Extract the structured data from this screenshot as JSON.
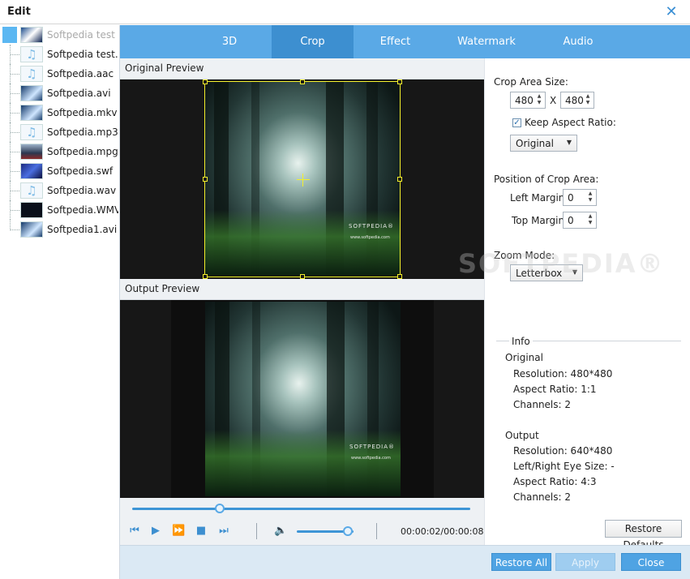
{
  "window": {
    "title": "Edit",
    "close_glyph": "✕"
  },
  "files": [
    {
      "name": "Softpedia test ...",
      "thumb": "video1",
      "selected": true
    },
    {
      "name": "Softpedia test...",
      "thumb": "audio"
    },
    {
      "name": "Softpedia.aac",
      "thumb": "audio"
    },
    {
      "name": "Softpedia.avi",
      "thumb": "video4"
    },
    {
      "name": "Softpedia.mkv",
      "thumb": "video4"
    },
    {
      "name": "Softpedia.mp3",
      "thumb": "audio"
    },
    {
      "name": "Softpedia.mpg",
      "thumb": "video2"
    },
    {
      "name": "Softpedia.swf",
      "thumb": "video3"
    },
    {
      "name": "Softpedia.wav",
      "thumb": "audio"
    },
    {
      "name": "Softpedia.WMV",
      "thumb": "dark"
    },
    {
      "name": "Softpedia1.avi",
      "thumb": "video4"
    }
  ],
  "tabs": [
    {
      "label": "3D"
    },
    {
      "label": "Crop",
      "active": true
    },
    {
      "label": "Effect"
    },
    {
      "label": "Watermark"
    },
    {
      "label": "Audio"
    }
  ],
  "preview": {
    "original_label": "Original Preview",
    "output_label": "Output Preview",
    "scene_logo": "SOFTPEDIA®",
    "scene_url": "www.softpedia.com"
  },
  "playback": {
    "timecode": "00:00:02/00:00:08",
    "progress": 0.26,
    "volume": 0.9
  },
  "crop": {
    "area_size_label": "Crop Area Size:",
    "width": "480",
    "x_label": "X",
    "height": "480",
    "keep_aspect_label": "Keep Aspect Ratio:",
    "keep_aspect_checked": true,
    "aspect_value": "Original",
    "position_label": "Position of Crop Area:",
    "left_margin_label": "Left Margin:",
    "left_margin": "0",
    "top_margin_label": "Top Margin:",
    "top_margin": "0",
    "zoom_label": "Zoom Mode:",
    "zoom_value": "Letterbox"
  },
  "info": {
    "title": "Info",
    "original_label": "Original",
    "original_resolution": "Resolution: 480*480",
    "original_aspect": "Aspect Ratio: 1:1",
    "original_channels": "Channels: 2",
    "output_label": "Output",
    "output_resolution": "Resolution: 640*480",
    "output_eye": "Left/Right Eye Size: -",
    "output_aspect": "Aspect Ratio: 4:3",
    "output_channels": "Channels: 2"
  },
  "buttons": {
    "restore_defaults": "Restore Defaults",
    "restore_all": "Restore All",
    "apply": "Apply",
    "close": "Close"
  },
  "watermark_text": "SOFTPEDIA®",
  "colors": {
    "accent": "#5aa9e6",
    "accent_dark": "#3d8fd0",
    "crop_frame": "#f3ef2b"
  }
}
